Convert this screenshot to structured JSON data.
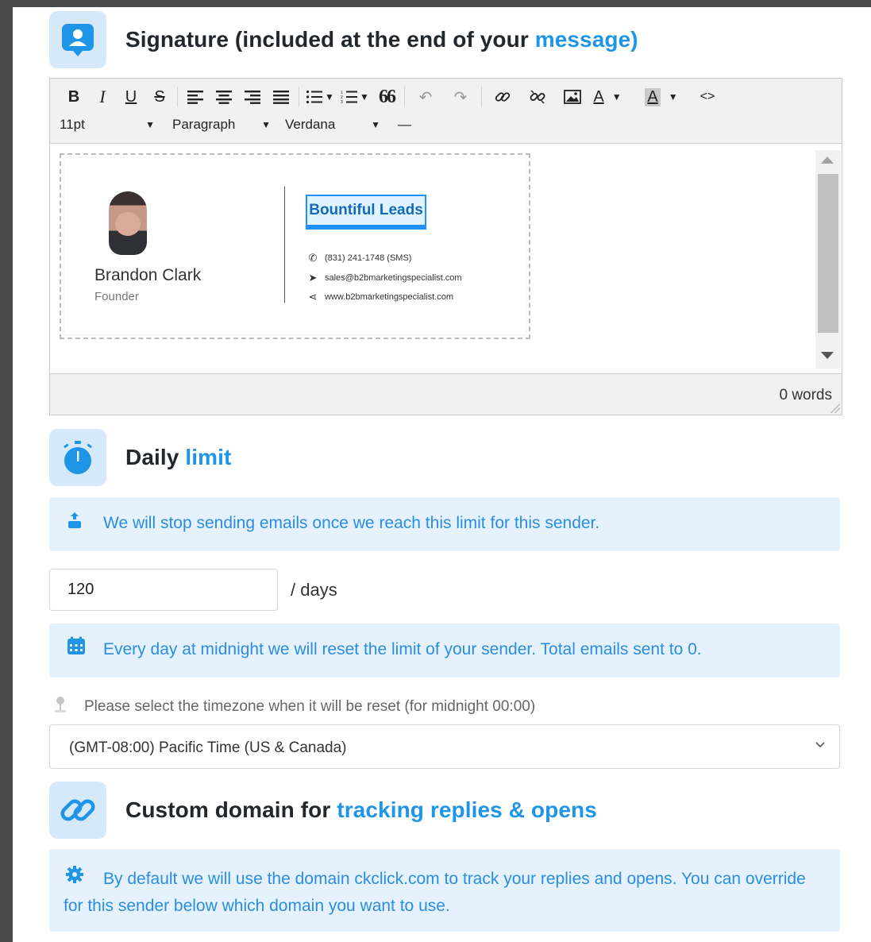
{
  "colors": {
    "accent": "#1f95e8",
    "icon_bg": "#d6e9fb",
    "info_bg": "#e5f1fd"
  },
  "signature_section": {
    "title_dark": "Signature (included at the end of your",
    "title_accent": "message)",
    "icon": "user-badge-icon"
  },
  "editor": {
    "toolbar": {
      "bold": "B",
      "italic": "I",
      "underline": "U",
      "strikethrough": "S",
      "blockquote": "66",
      "font_color": "A",
      "background_color": "A",
      "source_code": "<>",
      "font_size": "11pt",
      "block_format": "Paragraph",
      "font_family": "Verdana",
      "horizontal_rule": "—"
    },
    "word_count": "0 words"
  },
  "signature_card": {
    "name": "Brandon Clark",
    "role": "Founder",
    "logo_text": "Bountiful Leads",
    "phone": "(831) 241-1748 (SMS)",
    "email": "sales@b2bmarketingspecialist.com",
    "website": "www.b2bmarketingspecialist.com"
  },
  "daily_limit_section": {
    "title_dark": "Daily",
    "title_accent": "limit",
    "icon": "stopwatch-icon",
    "stop_info": "We will stop sending emails once we reach this limit for this sender.",
    "limit_value": "120",
    "per_unit": "/ days",
    "reset_info": "Every day at midnight we will reset the limit of your sender. Total emails sent to 0.",
    "timezone_label": "Please select the timezone when it will be reset (for midnight 00:00)",
    "timezone_value": "(GMT-08:00) Pacific Time (US & Canada)"
  },
  "custom_domain_section": {
    "title_dark": "Custom domain for",
    "title_accent": "tracking replies & opens",
    "icon": "link-icon",
    "info": "By default we will use the domain ckclick.com to track your replies and opens. You can override for this sender below which domain you want to use."
  }
}
